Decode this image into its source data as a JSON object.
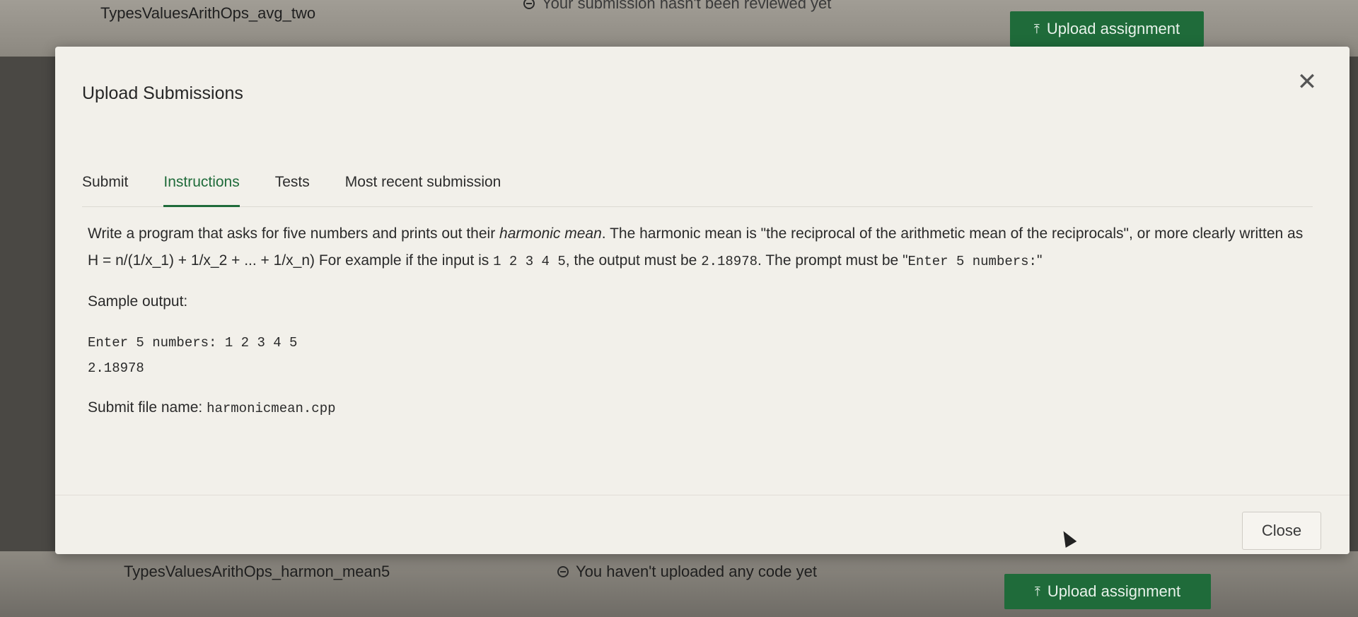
{
  "background": {
    "top_row": {
      "name": "TypesValuesArithOps_avg_two",
      "status": "Your submission hasn't been reviewed yet",
      "upload_label": "Upload assignment"
    },
    "bottom_row": {
      "name": "TypesValuesArithOps_harmon_mean5",
      "status": "You haven't uploaded any code yet",
      "upload_label": "Upload assignment"
    }
  },
  "modal": {
    "title": "Upload Submissions",
    "tabs": [
      {
        "label": "Submit"
      },
      {
        "label": "Instructions"
      },
      {
        "label": "Tests"
      },
      {
        "label": "Most recent submission"
      }
    ],
    "active_tab": "Instructions",
    "instructions": {
      "p1_a": "Write a program that asks for five numbers and prints out their ",
      "p1_em": "harmonic mean",
      "p1_b": ". The harmonic mean is \"the reciprocal of the arithmetic mean of the reciprocals\", or more clearly written as H = n/(1/x_1) + 1/x_2 + ... + 1/x_n) For example if the input is ",
      "p1_input": "1 2 3 4 5",
      "p1_c": ", the output must be ",
      "p1_output": "2.18978",
      "p1_d": ". The prompt must be \"",
      "p1_prompt": "Enter 5 numbers:",
      "p1_e": "\"",
      "sample_label": "Sample output:",
      "sample_line1": "Enter 5 numbers: 1 2 3 4 5",
      "sample_line2": "2.18978",
      "submit_label": "Submit file name: ",
      "submit_file": "harmonicmean.cpp"
    },
    "close_label": "Close"
  },
  "colors": {
    "accent": "#1f6b3a",
    "modal_bg": "#f2f0ea"
  }
}
